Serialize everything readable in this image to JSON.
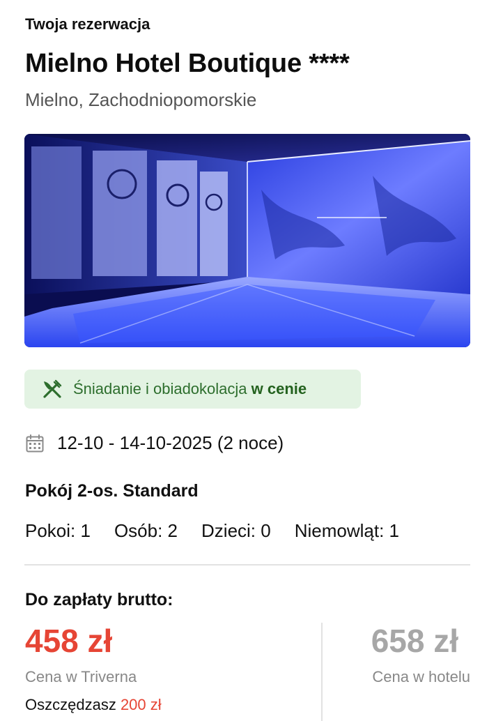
{
  "header": {
    "section_title": "Twoja rezerwacja",
    "hotel_name": "Mielno Hotel Boutique ****",
    "location": "Mielno, Zachodniopomorskie"
  },
  "meal_plan": {
    "prefix": "Śniadanie i obiadokolacja ",
    "suffix": "w cenie",
    "icon": "fork-knife-icon"
  },
  "stay": {
    "dates": "12-10 - 14-10-2025 (2 noce)",
    "icon": "calendar-icon"
  },
  "room": {
    "type": "Pokój 2-os. Standard",
    "occupancy": {
      "rooms": "Pokoi: 1",
      "persons": "Osób: 2",
      "children": "Dzieci: 0",
      "infants": "Niemowląt: 1"
    }
  },
  "payment": {
    "label": "Do zapłaty brutto:",
    "our_price": "458 zł",
    "our_price_label": "Cena w Triverna",
    "savings_prefix": "Oszczędzasz ",
    "savings_amount": "200 zł",
    "hotel_price": "658 zł",
    "hotel_price_label": "Cena w hotelu"
  },
  "colors": {
    "accent_red": "#e64535",
    "badge_green_bg": "#e3f3e3",
    "badge_green_text": "#2d6e2d",
    "muted_gray": "#a7a7a7"
  }
}
